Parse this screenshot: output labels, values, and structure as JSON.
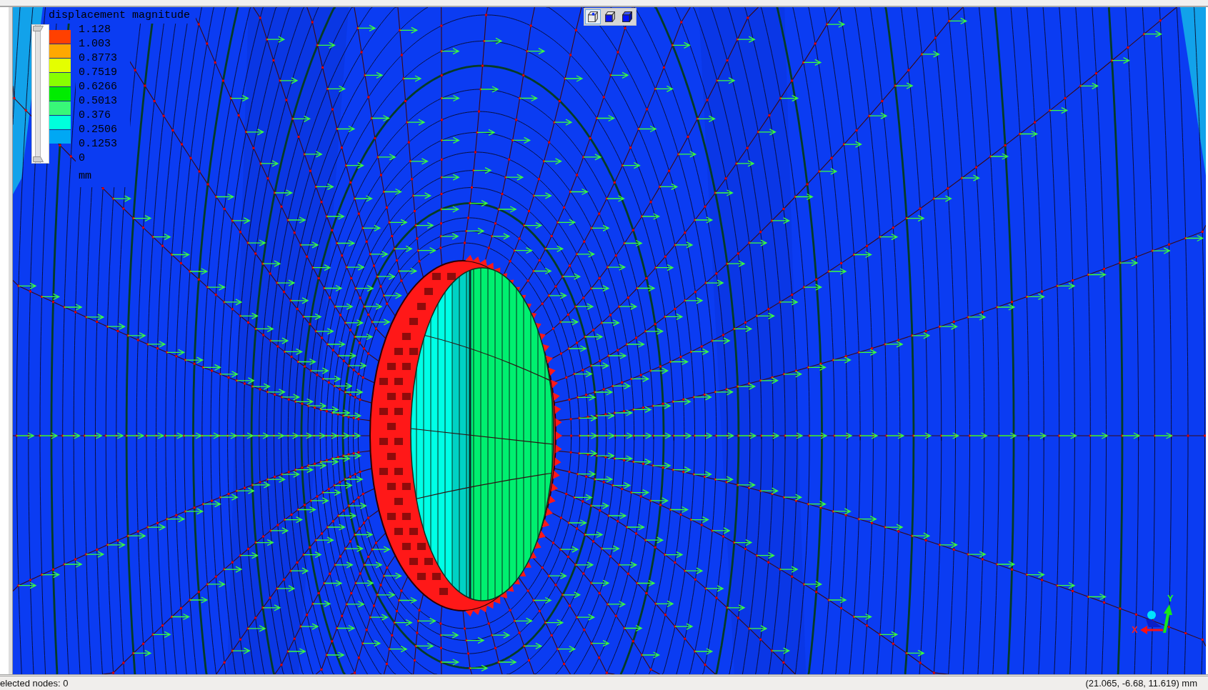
{
  "viewport": {
    "legend": {
      "title": "displacement magnitude",
      "range_slider": {
        "level": 1
      },
      "bands": [
        {
          "color": "#ff4000"
        },
        {
          "color": "#ffa800"
        },
        {
          "color": "#e4ff00"
        },
        {
          "color": "#88ff00"
        },
        {
          "color": "#00ec00"
        },
        {
          "color": "#38f878"
        },
        {
          "color": "#00ffdc"
        },
        {
          "color": "#00a8f4"
        }
      ],
      "labels": [
        "1.128",
        "1.003",
        "0.8773",
        "0.7519",
        "0.6266",
        "0.5013",
        "0.376",
        "0.2506",
        "0.1253",
        "0"
      ],
      "unit": "mm"
    },
    "view_toolbar": [
      {
        "kind": "wireframe",
        "selected": true
      },
      {
        "kind": "front-face",
        "selected": false
      },
      {
        "kind": "solid",
        "selected": false
      }
    ],
    "axis_triad": {
      "x_label": "X",
      "y_label": "Y"
    }
  },
  "status_bar": {
    "selection": "elected nodes: 0",
    "coordinates": "(21.065, -6.68, 11.619) mm"
  }
}
